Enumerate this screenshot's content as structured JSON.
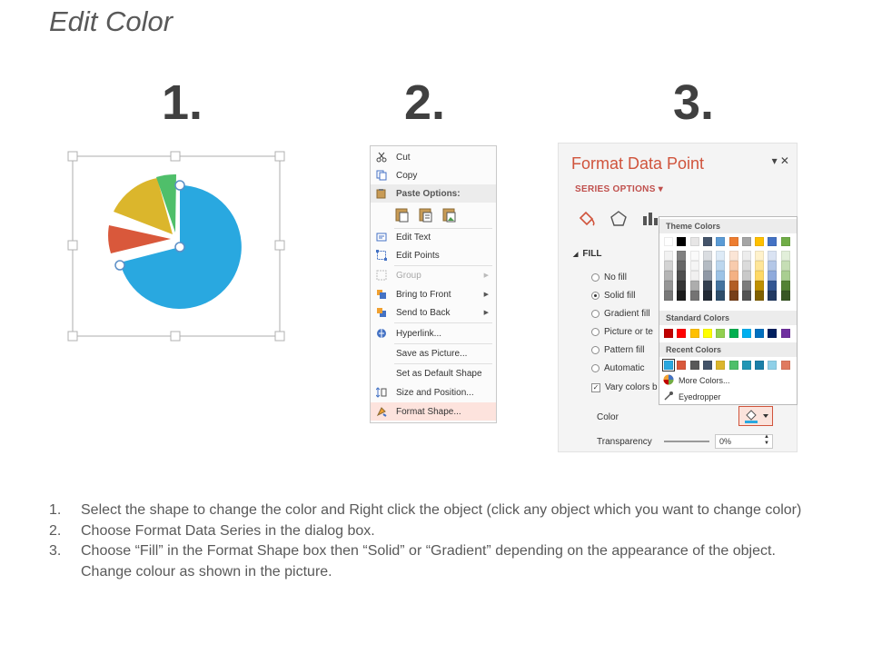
{
  "page": {
    "title": "Edit Color",
    "steps": [
      "1.",
      "2.",
      "3."
    ]
  },
  "pie": {
    "colors": [
      "#29a8e0",
      "#d9583b",
      "#dbb62c",
      "#4fbf6a"
    ],
    "selected_slice": "blue"
  },
  "context_menu": {
    "items": [
      {
        "label": "Cut",
        "icon": "scissors-icon"
      },
      {
        "label": "Copy",
        "icon": "copy-icon"
      },
      {
        "label": "Paste Options:",
        "icon": "paste-icon"
      },
      {
        "label": "Edit Text",
        "icon": "edit-text-icon"
      },
      {
        "label": "Edit Points",
        "icon": "edit-points-icon"
      },
      {
        "label": "Group",
        "icon": "group-icon"
      },
      {
        "label": "Bring to Front",
        "icon": "bring-front-icon"
      },
      {
        "label": "Send to Back",
        "icon": "send-back-icon"
      },
      {
        "label": "Hyperlink...",
        "icon": "hyperlink-icon"
      },
      {
        "label": "Save as Picture...",
        "icon": ""
      },
      {
        "label": "Set as Default Shape",
        "icon": ""
      },
      {
        "label": "Size and Position...",
        "icon": "size-position-icon"
      },
      {
        "label": "Format Shape...",
        "icon": "format-shape-icon"
      }
    ]
  },
  "format_panel": {
    "title": "Format Data Point",
    "close": "▾ ✕",
    "series_options": "SERIES OPTIONS ▾",
    "fill_header": "FILL",
    "options": [
      {
        "label": "No fill",
        "checked": false
      },
      {
        "label": "Solid fill",
        "checked": true
      },
      {
        "label": "Gradient fill",
        "checked": false
      },
      {
        "label": "Picture or te",
        "checked": false
      },
      {
        "label": "Pattern fill",
        "checked": false
      },
      {
        "label": "Automatic",
        "checked": false
      }
    ],
    "vary_colors": "Vary colors b",
    "color_label": "Color",
    "transparency_label": "Transparency",
    "transparency_value": "0%"
  },
  "color_picker": {
    "theme_header": "Theme Colors",
    "standard_header": "Standard Colors",
    "recent_header": "Recent Colors",
    "more_colors": "More Colors...",
    "eyedropper": "Eyedropper",
    "theme_top": [
      "#ffffff",
      "#000000",
      "#e7e6e6",
      "#44546a",
      "#5b9bd5",
      "#ed7d31",
      "#a5a5a5",
      "#ffc000",
      "#4472c4",
      "#70ad47"
    ],
    "standard": [
      "#c00000",
      "#ff0000",
      "#ffc000",
      "#ffff00",
      "#92d050",
      "#00b050",
      "#00b0f0",
      "#0070c0",
      "#002060",
      "#7030a0"
    ],
    "recent": [
      "#29a8e0",
      "#d9583b",
      "#595959",
      "#44546a",
      "#dbb62c",
      "#4fbf6a",
      "#2196b5",
      "#1a7fa8",
      "#8fd0e8",
      "#e07a5f"
    ]
  },
  "instructions": [
    {
      "num": "1.",
      "text": "Select the shape to change the color and Right click the object (click any object which you want to change color)"
    },
    {
      "num": "2.",
      "text": "Choose Format Data Series in the dialog box."
    },
    {
      "num": "3.",
      "text": "Choose “Fill” in the Format Shape box then “Solid” or “Gradient” depending on the appearance of the object. Change colour as shown in the picture."
    }
  ]
}
